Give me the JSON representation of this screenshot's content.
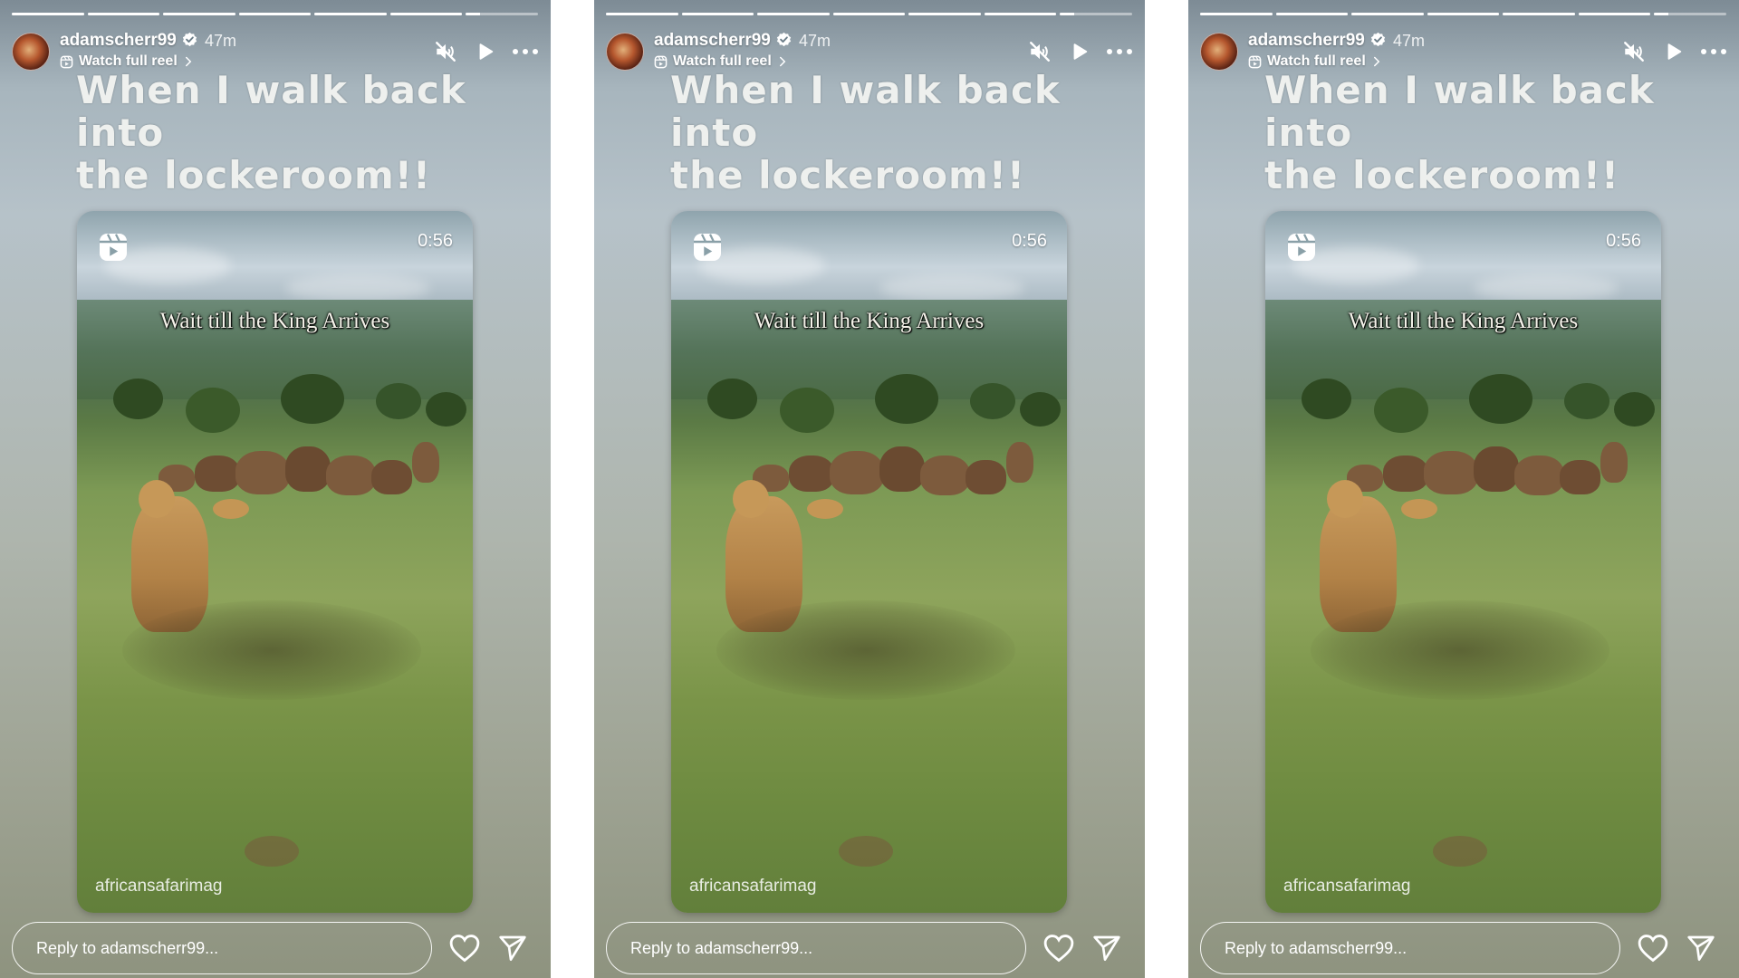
{
  "colors": {
    "text": "#ffffff",
    "progress_track": "rgba(255,255,255,0.45)",
    "progress_fill": "#ffffff"
  },
  "icons": [
    "verified-badge-icon",
    "reel-icon",
    "mute-icon",
    "play-icon",
    "more-icon",
    "heart-icon",
    "send-icon",
    "chevron-right-icon"
  ],
  "stories": [
    {
      "username": "adamscherr99",
      "time": "47m",
      "watch_full_reel": "Watch full reel",
      "caption_line1": "When I walk back into",
      "caption_line2": "the lockeroom!!",
      "reel": {
        "duration": "0:56",
        "overlay_text": "Wait till the King Arrives",
        "credit": "africansafarimag"
      },
      "reply_placeholder": "Reply to adamscherr99...",
      "progress": [
        1,
        1,
        1,
        1,
        1,
        1,
        0.2
      ]
    },
    {
      "username": "adamscherr99",
      "time": "47m",
      "watch_full_reel": "Watch full reel",
      "caption_line1": "When I walk back into",
      "caption_line2": "the lockeroom!!",
      "reel": {
        "duration": "0:56",
        "overlay_text": "Wait till the King Arrives",
        "credit": "africansafarimag"
      },
      "reply_placeholder": "Reply to adamscherr99...",
      "progress": [
        1,
        1,
        1,
        1,
        1,
        1,
        0.2
      ]
    },
    {
      "username": "adamscherr99",
      "time": "47m",
      "watch_full_reel": "Watch full reel",
      "caption_line1": "When I walk back into",
      "caption_line2": "the lockeroom!!",
      "reel": {
        "duration": "0:56",
        "overlay_text": "Wait till the King Arrives",
        "credit": "africansafarimag"
      },
      "reply_placeholder": "Reply to adamscherr99...",
      "progress": [
        1,
        1,
        1,
        1,
        1,
        1,
        0.2
      ]
    }
  ]
}
